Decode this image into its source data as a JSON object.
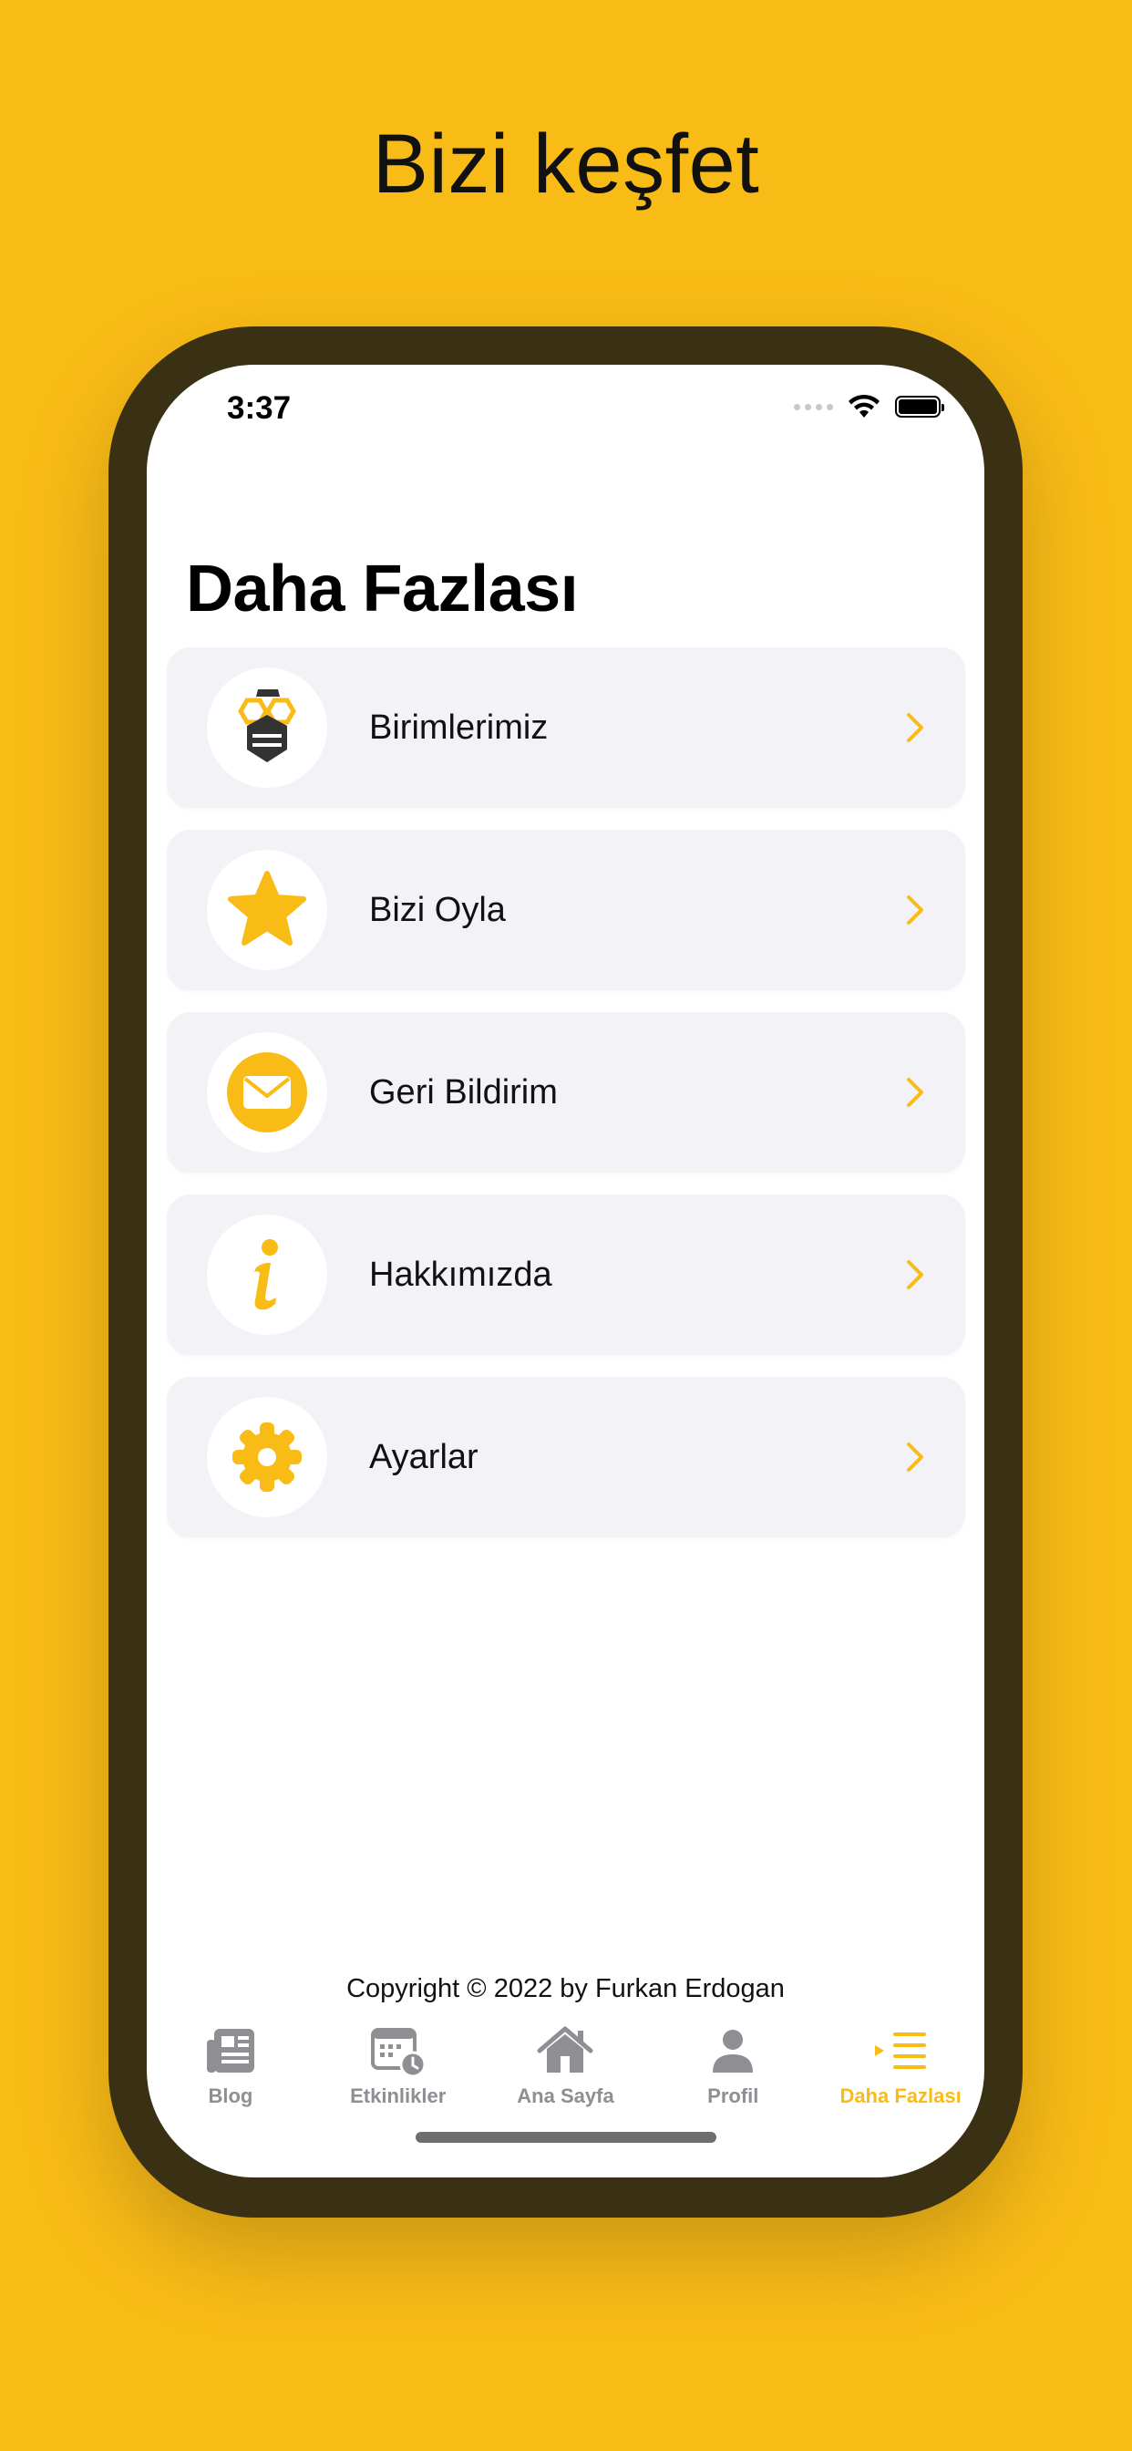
{
  "headline": "Bizi keşfet",
  "status_bar": {
    "time": "3:37",
    "icons": [
      "cellular-signal-icon",
      "wifi-icon",
      "battery-icon"
    ]
  },
  "page_title": "Daha Fazlası",
  "menu": {
    "items": [
      {
        "label": "Birimlerimiz",
        "icon": "bee-logo-icon"
      },
      {
        "label": "Bizi Oyla",
        "icon": "star-icon"
      },
      {
        "label": "Geri Bildirim",
        "icon": "envelope-icon"
      },
      {
        "label": "Hakkımızda",
        "icon": "info-icon"
      },
      {
        "label": "Ayarlar",
        "icon": "gear-icon"
      }
    ]
  },
  "copyright": "Copyright © 2022 by Furkan Erdogan",
  "tab_bar": {
    "tabs": [
      {
        "label": "Blog",
        "icon": "newspaper-icon",
        "active": false
      },
      {
        "label": "Etkinlikler",
        "icon": "calendar-clock-icon",
        "active": false
      },
      {
        "label": "Ana Sayfa",
        "icon": "house-icon",
        "active": false
      },
      {
        "label": "Profil",
        "icon": "person-icon",
        "active": false
      },
      {
        "label": "Daha Fazlası",
        "icon": "list-icon",
        "active": true
      }
    ]
  },
  "colors": {
    "background": "#F9BB16",
    "accent": "#F9BB16",
    "frame": "#3A3013",
    "row_background": "#F2F2F7",
    "tab_inactive": "#8E8E93"
  }
}
